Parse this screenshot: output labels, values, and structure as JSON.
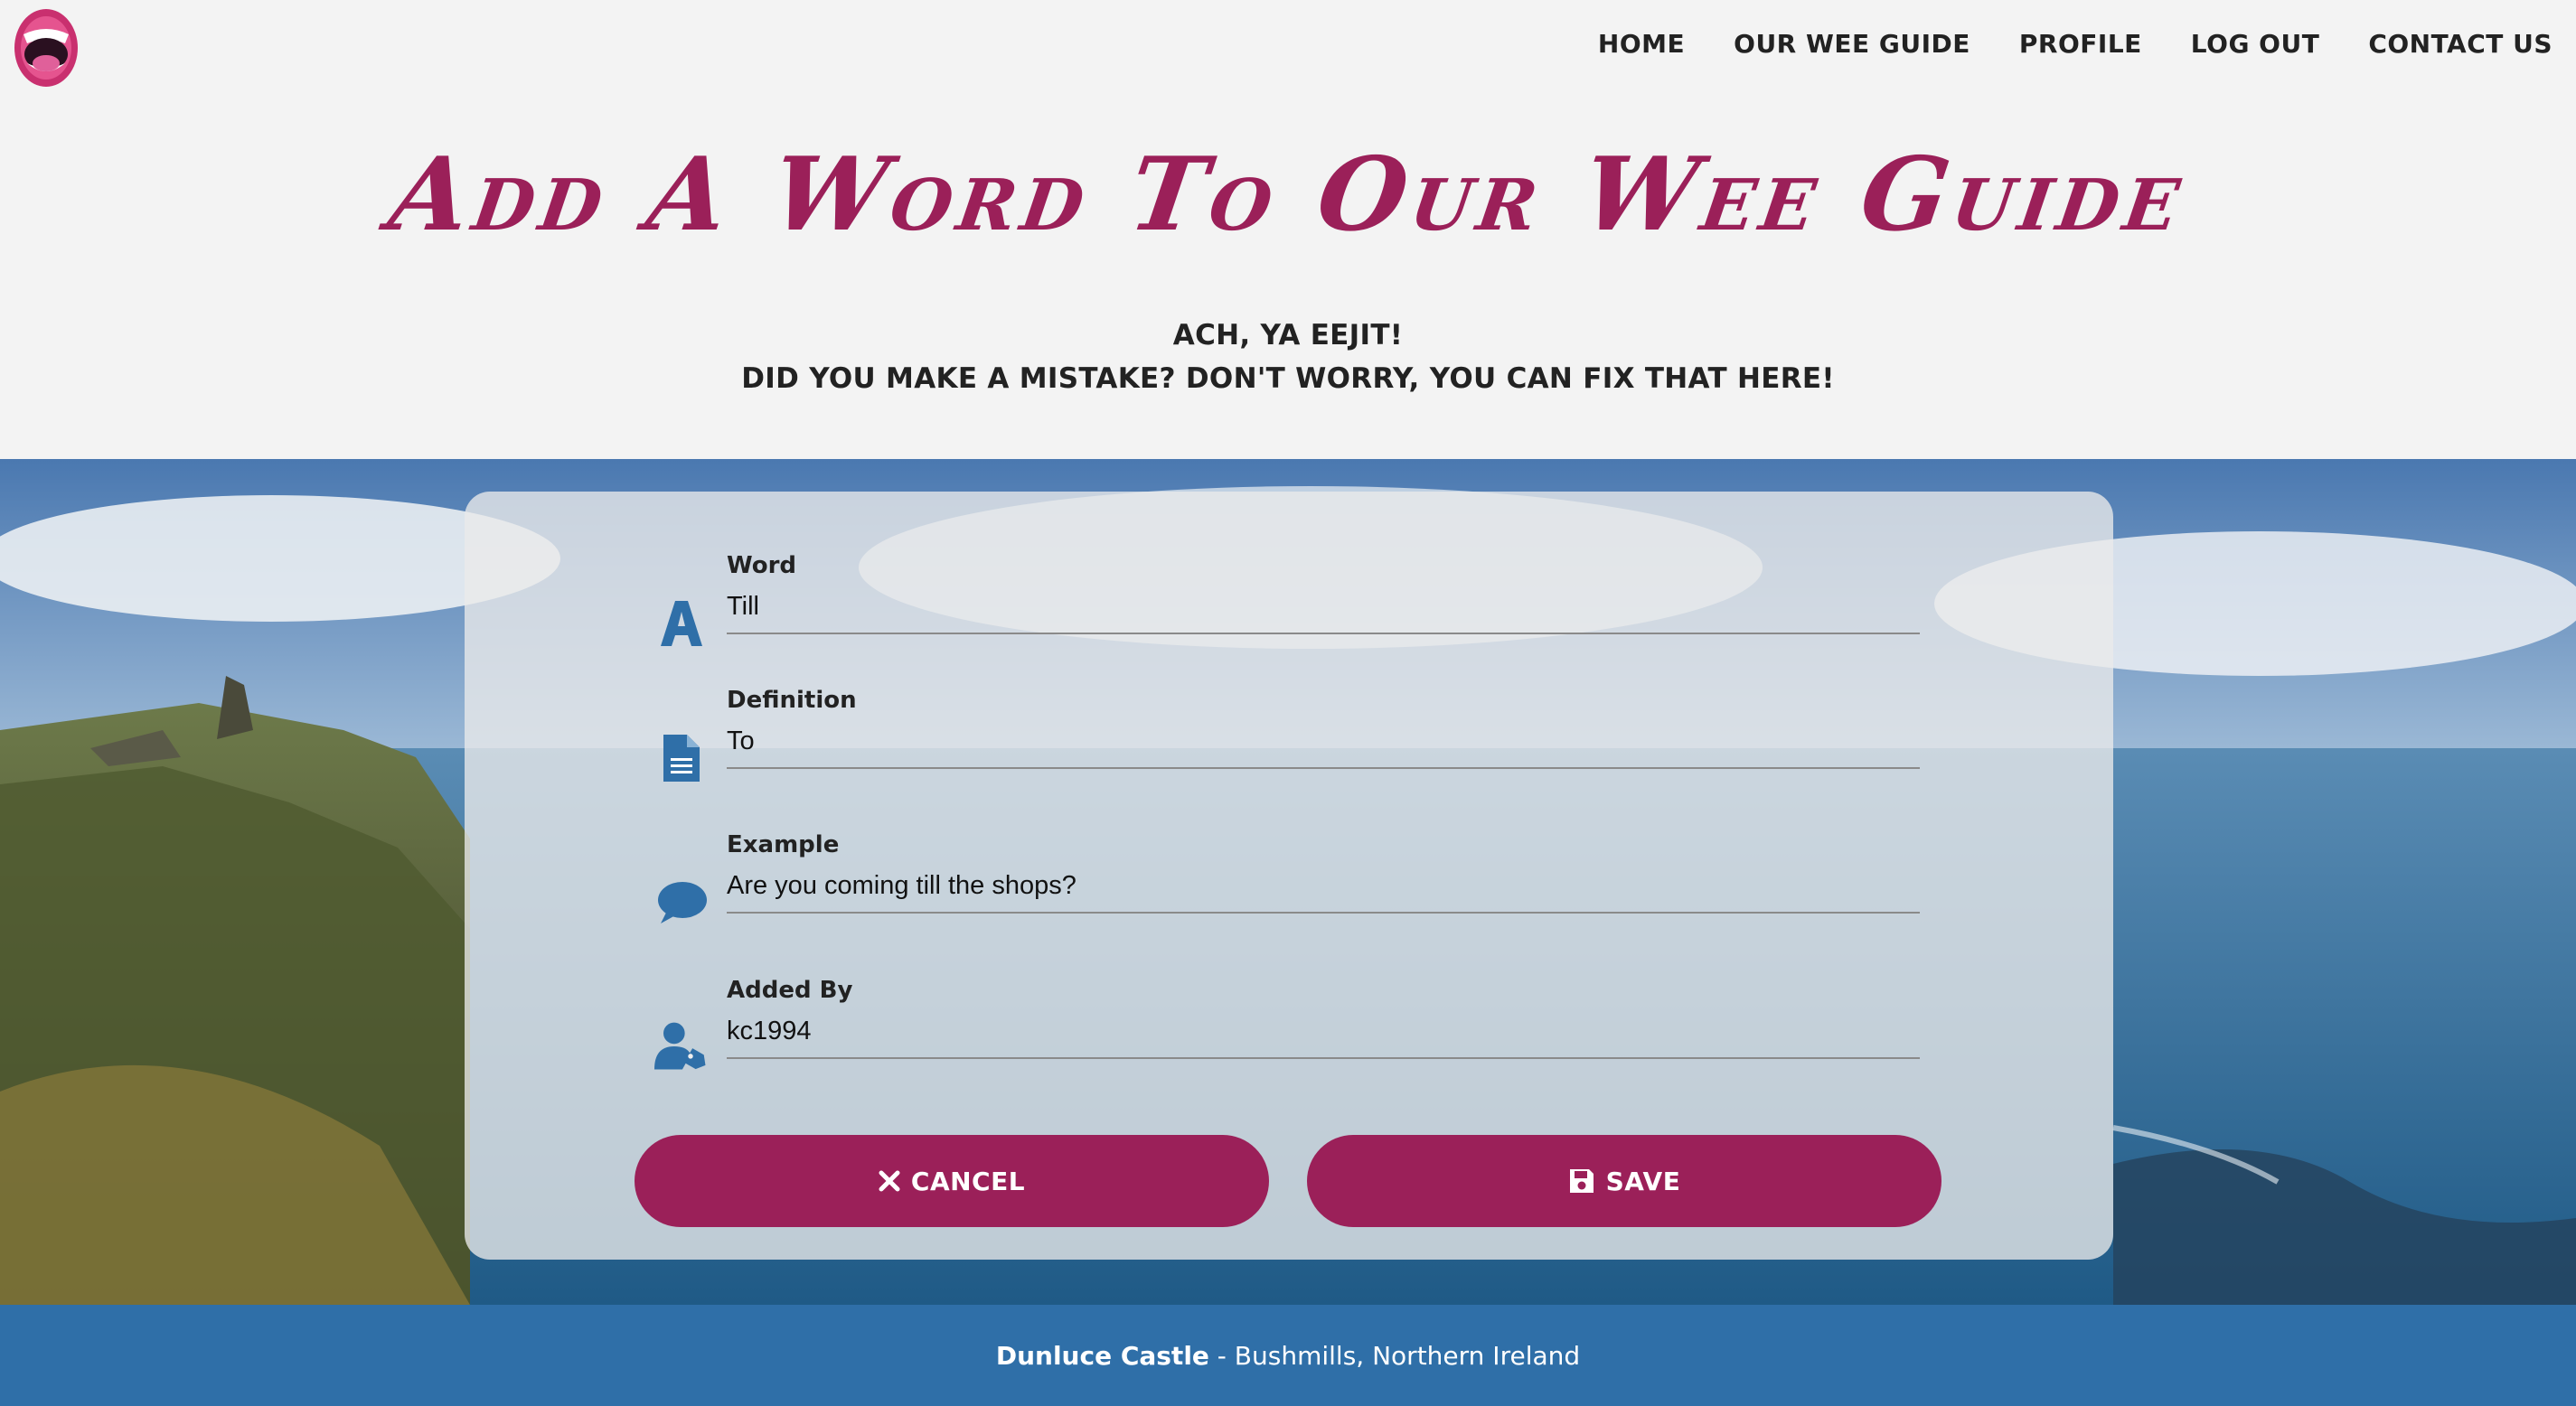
{
  "nav": {
    "logo": "mouth-logo",
    "links": [
      "HOME",
      "OUR WEE GUIDE",
      "PROFILE",
      "LOG OUT",
      "CONTACT US"
    ]
  },
  "header": {
    "title": "Add A Word To Our Wee Guide",
    "subtitle_line1": "ACH, YA EEJIT!",
    "subtitle_line2": "DID YOU MAKE A MISTAKE? DON'T WORRY, YOU CAN FIX THAT HERE!"
  },
  "form": {
    "fields": [
      {
        "label": "Word",
        "value": "Till",
        "icon": "letter-a-icon"
      },
      {
        "label": "Definition",
        "value": "To",
        "icon": "document-icon"
      },
      {
        "label": "Example",
        "value": "Are you coming till the shops?",
        "icon": "speech-bubble-icon"
      },
      {
        "label": "Added By",
        "value": "kc1994",
        "icon": "user-tag-icon"
      }
    ],
    "cancel_label": "CANCEL",
    "save_label": "SAVE"
  },
  "footer": {
    "place": "Dunluce Castle",
    "location": " - Bushmills, Northern Ireland"
  },
  "colors": {
    "accent": "#9b2059",
    "icon": "#2f6fa8",
    "footer": "#2f6fa8",
    "background": "#f3f3f3"
  }
}
